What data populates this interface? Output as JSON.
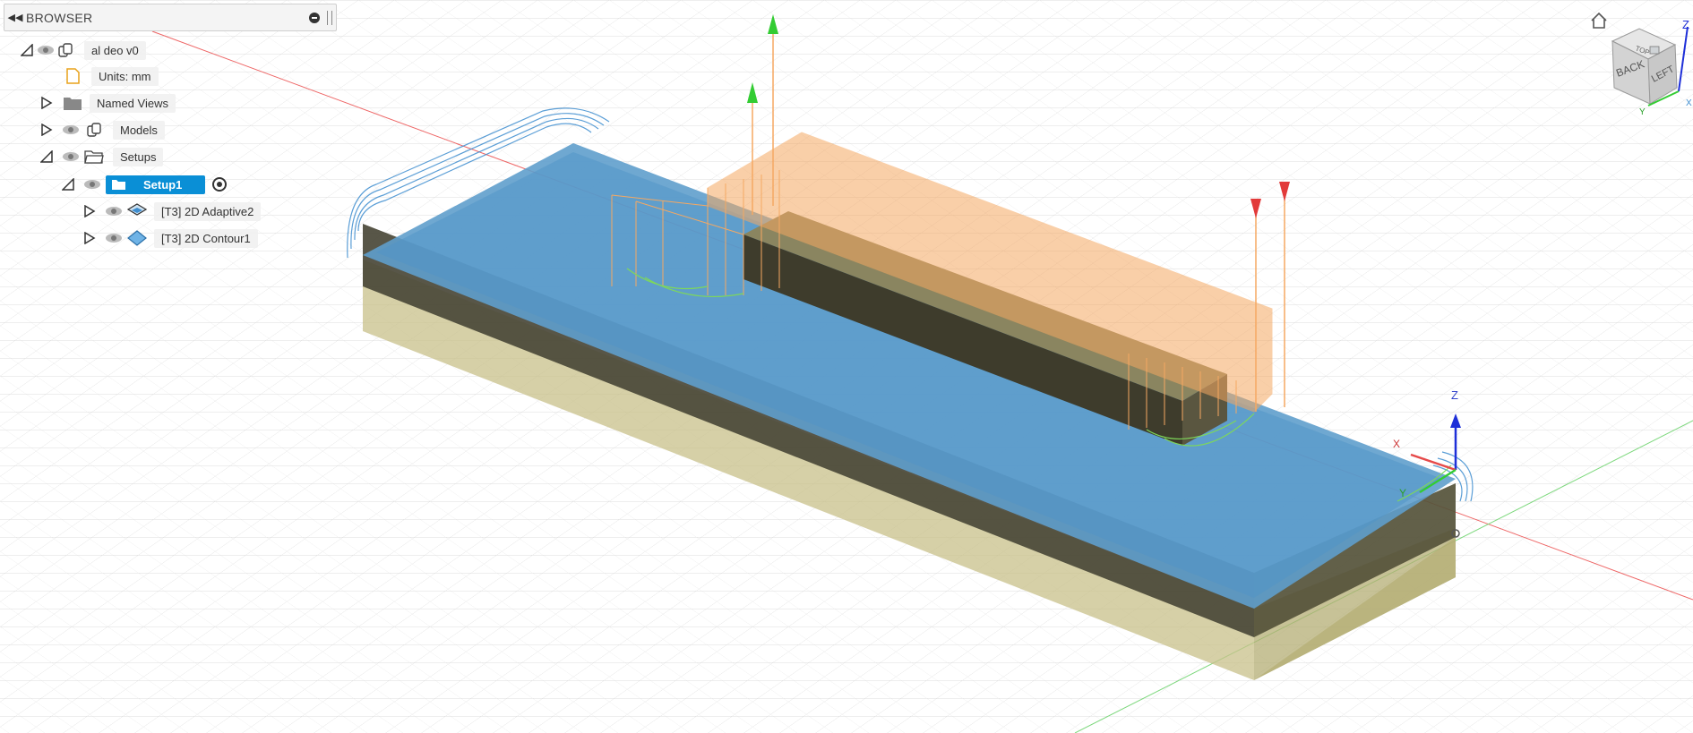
{
  "browser": {
    "title": "BROWSER",
    "collapse_glyph": "◀◀",
    "items": [
      {
        "label": "al deo v0",
        "icon": "component-icon"
      },
      {
        "label": "Units: mm",
        "icon": "document-icon"
      },
      {
        "label": "Named Views",
        "icon": "folder-icon"
      },
      {
        "label": "Models",
        "icon": "component-icon"
      },
      {
        "label": "Setups",
        "icon": "setup-folder-icon"
      },
      {
        "label": "Setup1",
        "icon": "setup-icon",
        "selected": true
      },
      {
        "label": "[T3] 2D Adaptive2",
        "icon": "adaptive-op-icon"
      },
      {
        "label": "[T3] 2D Contour1",
        "icon": "contour-op-icon"
      }
    ]
  },
  "viewcube": {
    "faces": [
      "BACK",
      "LEFT",
      "TOP"
    ],
    "axes": [
      "Z",
      "Y",
      "X"
    ]
  },
  "triad": {
    "z_label": "Z",
    "x_label": "X",
    "y_label": "Y"
  },
  "colors": {
    "stock_blue": "#5f9fcc",
    "toolpath_orange": "#f5a862",
    "toolpath_blue": "#3f8ed0",
    "toolpath_green": "#7ed85a",
    "selection_blue": "#0a8fd6",
    "part_olive": "#b4ad74",
    "part_dark": "#55523a",
    "axis_red": "#e64a4a",
    "axis_green": "#33cc33",
    "axis_blue": "#1e2fd8"
  }
}
